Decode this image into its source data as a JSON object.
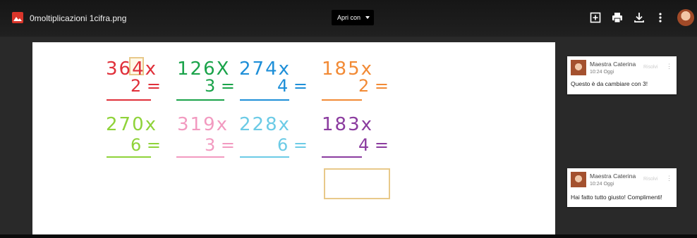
{
  "header": {
    "file_name": "0moltiplicazioni 1cifra.png",
    "open_with_label": "Apri con",
    "buttons": [
      "add-comment-icon",
      "print-icon",
      "download-icon",
      "more-vert-icon"
    ]
  },
  "document": {
    "rows": [
      [
        {
          "top": "364x",
          "bottom": "2 =",
          "color": "#e0303a"
        },
        {
          "top": "126X",
          "bottom": "3 =",
          "color": "#1aa34a"
        },
        {
          "top": "274x",
          "bottom": "4 =",
          "color": "#1e8fd8"
        },
        {
          "top": "185x",
          "bottom": "2 =",
          "color": "#f28a35"
        }
      ],
      [
        {
          "top": "270x",
          "bottom": "6 =",
          "color": "#8fd33a"
        },
        {
          "top": "319x",
          "bottom": "3 =",
          "color": "#f29ac0"
        },
        {
          "top": "228x",
          "bottom": "6 =",
          "color": "#6ccbe6"
        },
        {
          "top": "183x",
          "bottom": "4 =",
          "color": "#8b3c9f"
        }
      ]
    ],
    "highlight_color": "#e8c98a"
  },
  "comments": [
    {
      "author": "Maestra Caterina",
      "time": "10:24 Oggi",
      "resolve_label": "Risolvi",
      "text": "Questo è da cambiare con 3!"
    },
    {
      "author": "Maestra Caterina",
      "time": "10:24 Oggi",
      "resolve_label": "Risolvi",
      "text": "Hai fatto tutto giusto! Complimenti!"
    }
  ]
}
